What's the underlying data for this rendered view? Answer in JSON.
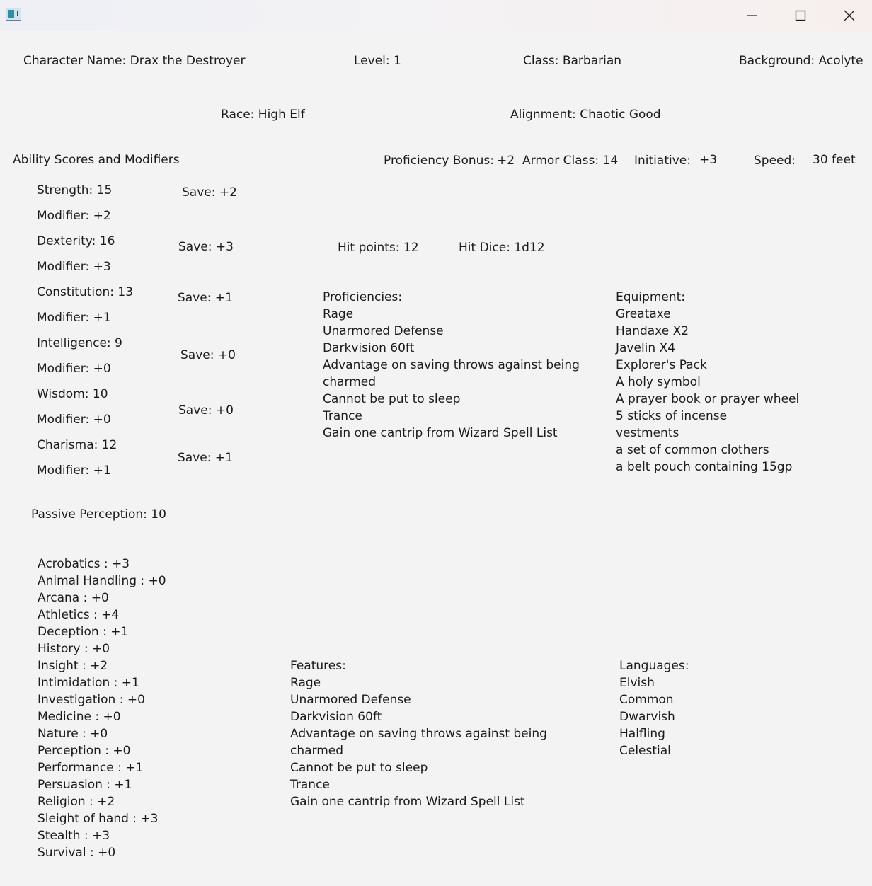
{
  "window": {
    "icons": {
      "app": "app-icon",
      "minimize": "minimize-icon",
      "maximize": "maximize-icon",
      "close": "close-icon"
    }
  },
  "header": {
    "character_name": "Character Name: Drax the Destroyer",
    "level": "Level: 1",
    "class": "Class: Barbarian",
    "background": "Background: Acolyte",
    "race": "Race: High Elf",
    "alignment": "Alignment: Chaotic Good"
  },
  "abilities": {
    "title": "Ability Scores and Modifiers",
    "strength": {
      "score": "Strength: 15",
      "modifier": "Modifier: +2",
      "save": "Save: +2"
    },
    "dexterity": {
      "score": "Dexterity: 16",
      "modifier": "Modifier: +3",
      "save": "Save: +3"
    },
    "constitution": {
      "score": "Constitution: 13",
      "modifier": "Modifier: +1",
      "save": "Save: +1"
    },
    "intelligence": {
      "score": "Intelligence: 9",
      "modifier": "Modifier: +0",
      "save": "Save: +0"
    },
    "wisdom": {
      "score": "Wisdom: 10",
      "modifier": "Modifier: +0",
      "save": "Save: +0"
    },
    "charisma": {
      "score": "Charisma: 12",
      "modifier": "Modifier: +1",
      "save": "Save: +1"
    }
  },
  "combat": {
    "proficiency_label": "Proficiency Bonus:",
    "proficiency_value": "+2",
    "armor_class": "Armor Class: 14",
    "initiative_label": "Initiative:",
    "initiative_value": "+3",
    "speed_label": "Speed:",
    "speed_value": "30 feet",
    "hit_points": "Hit points: 12",
    "hit_dice": "Hit Dice: 1d12"
  },
  "passive_perception": "Passive Perception: 10",
  "proficiencies": {
    "title": "Proficiencies:",
    "items": [
      "Rage",
      "Unarmored Defense",
      "Darkvision 60ft",
      "Advantage on saving throws against being",
      "charmed",
      "Cannot be put to sleep",
      "Trance",
      "Gain one cantrip from Wizard Spell List"
    ]
  },
  "equipment": {
    "title": "Equipment:",
    "items": [
      "Greataxe",
      "Handaxe X2",
      "Javelin X4",
      "Explorer's Pack",
      "A holy symbol",
      "A prayer book or prayer wheel",
      "5 sticks of incense",
      "vestments",
      "a set of common clothers",
      "a belt pouch containing 15gp"
    ]
  },
  "skills": {
    "items": [
      "Acrobatics : +3",
      "Animal Handling : +0",
      "Arcana : +0",
      "Athletics : +4",
      "Deception : +1",
      "History : +0",
      "Insight : +2",
      "Intimidation : +1",
      "Investigation : +0",
      "Medicine : +0",
      "Nature : +0",
      "Perception : +0",
      "Performance : +1",
      "Persuasion : +1",
      "Religion : +2",
      "Sleight of hand : +3",
      "Stealth : +3",
      "Survival : +0"
    ]
  },
  "features": {
    "title": "Features:",
    "items": [
      "Rage",
      "Unarmored Defense",
      "Darkvision 60ft",
      "Advantage on saving throws against being",
      "charmed",
      "Cannot be put to sleep",
      "Trance",
      "Gain one cantrip from Wizard Spell List"
    ]
  },
  "languages": {
    "title": "Languages:",
    "items": [
      "Elvish",
      "Common",
      "Dwarvish",
      "Halfling",
      "Celestial"
    ]
  }
}
